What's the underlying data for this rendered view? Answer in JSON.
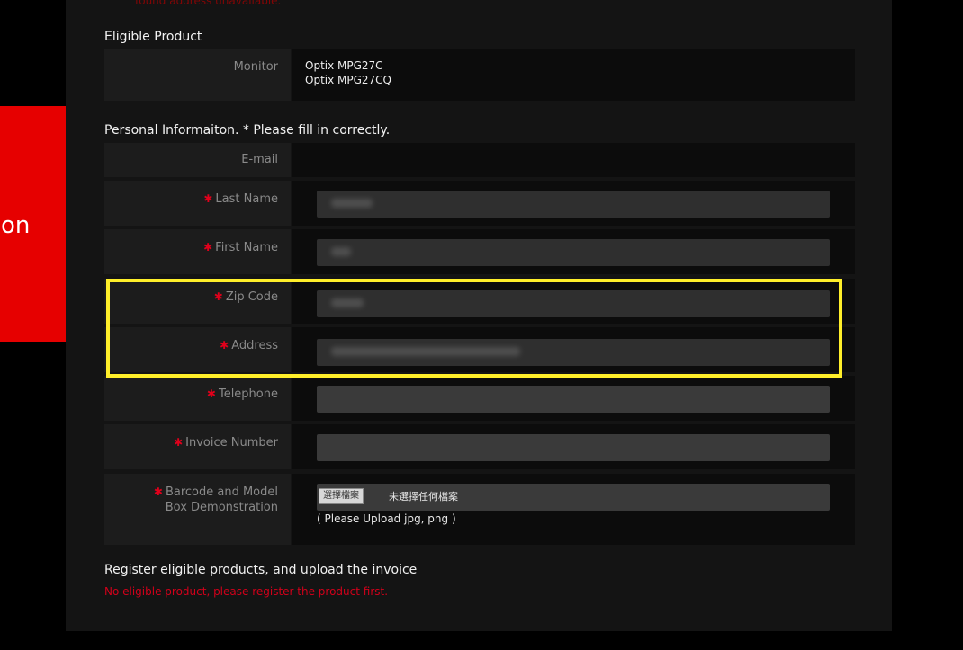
{
  "top_warning": "found address unavailable.",
  "eligible_product": {
    "title": "Eligible Product",
    "label": "Monitor",
    "products": [
      "Optix MPG27C",
      "Optix MPG27CQ"
    ]
  },
  "personal": {
    "title": "Personal Informaiton. * Please fill in correctly.",
    "fields": [
      {
        "label": "E-mail",
        "required": false,
        "value": ""
      },
      {
        "label": "Last Name",
        "required": true,
        "value": "(blurred)"
      },
      {
        "label": "First Name",
        "required": true,
        "value": "(blurred)"
      },
      {
        "label": "Zip Code",
        "required": true,
        "value": "(blurred)"
      },
      {
        "label": "Address",
        "required": true,
        "value": "(blurred)"
      },
      {
        "label": "Telephone",
        "required": true,
        "value": ""
      },
      {
        "label": "Invoice Number",
        "required": true,
        "value": ""
      }
    ],
    "barcode": {
      "label_line1": "Barcode and Model",
      "label_line2": "Box Demonstration",
      "button_label": "選擇檔案",
      "status": "未選擇任何檔案",
      "hint": "( Please Upload jpg, png )"
    }
  },
  "required_mark": "✱",
  "overlay_text": "on",
  "footer": {
    "title": "Register eligible products, and upload the invoice",
    "warning": "No eligible product, please register the product first."
  },
  "colors": {
    "required": "#e0001b",
    "highlight": "#ffef2a",
    "overlay": "#e60000"
  }
}
